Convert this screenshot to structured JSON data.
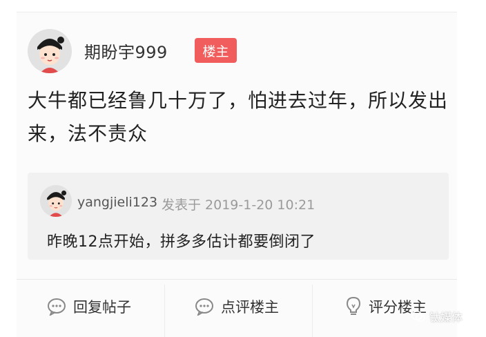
{
  "post": {
    "author": "期盼宇999",
    "badge": "楼主",
    "content": "大牛都已经鲁几十万了，怕进去过年，所以发出来，法不责众"
  },
  "reply": {
    "username": "yangjieli123",
    "meta": "发表于 2019-1-20 10:21",
    "text": "昨晚12点开始，拼多多估计都要倒闭了"
  },
  "actions": {
    "reply_label": "回复帖子",
    "comment_label": "点评楼主",
    "rate_label": "评分楼主"
  },
  "watermark": "钛媒体",
  "colors": {
    "badge": "#f15d5d",
    "meta": "#9a9a9a",
    "reply_bg": "#f1f1f1"
  }
}
